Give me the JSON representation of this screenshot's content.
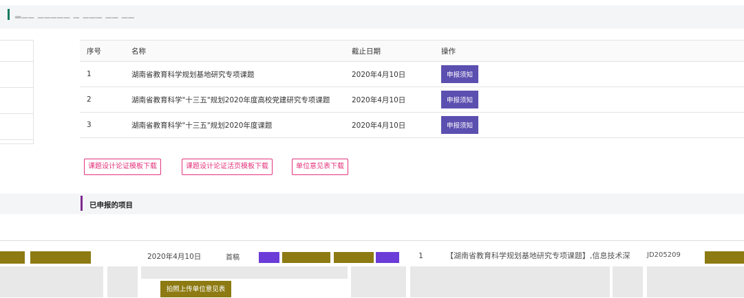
{
  "header": {
    "title": "▂▁▁ ▁▁▁▁▁ ▁ ▁▁▁ ▁▁ ▁▁"
  },
  "table": {
    "columns": [
      "序号",
      "名称",
      "截止日期",
      "操作"
    ],
    "rows": [
      {
        "index": "1",
        "name": "湖南省教育科学规划基地研究专项课题",
        "deadline": "2020年4月10日",
        "action": "申报须知"
      },
      {
        "index": "2",
        "name": "湖南省教育科学\"十三五\"规划2020年度高校党建研究专项课题",
        "deadline": "2020年4月10日",
        "action": "申报须知"
      },
      {
        "index": "3",
        "name": "湖南省教育科学\"十三五\"规划2020年度课题",
        "deadline": "2020年4月10日",
        "action": "申报须知"
      }
    ]
  },
  "downloads": {
    "design_template": "课题设计论证模板下载",
    "design_page_template": "课题设计论证活页模板下载",
    "unit_opinion": "单位意见表下载"
  },
  "submitted": {
    "title": "已申报的项目",
    "row_date": "2020年4月10日",
    "row_status": "首稿",
    "row_index": "1",
    "row_name": "【湖南省教育科学规划基地研究专项课题】,信息技术深",
    "row_code": "JD205209",
    "upload_button": "拍照上传单位意见表"
  },
  "colors": {
    "accent_green": "#0e7a5e",
    "accent_purple": "#7b2a8e",
    "action_violet": "#5b4fb0",
    "download_pink": "#e3327a",
    "olive": "#8d7a12"
  }
}
